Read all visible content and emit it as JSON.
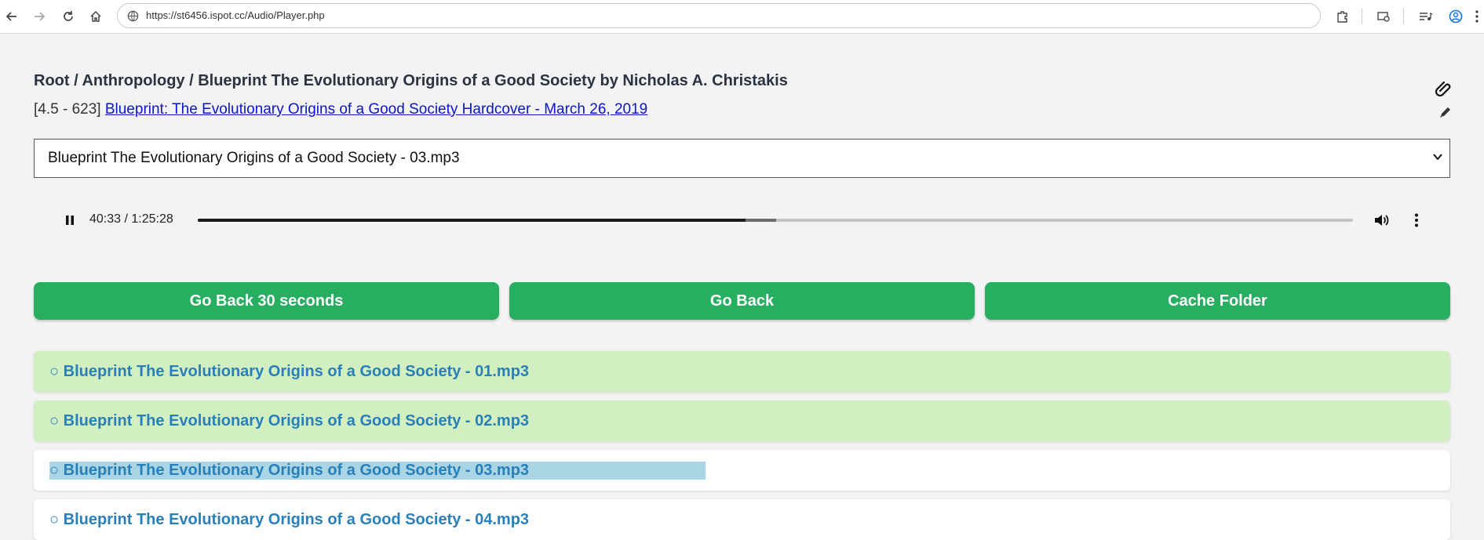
{
  "browser": {
    "url": "https://st6456.ispot.cc/Audio/Player.php"
  },
  "page": {
    "breadcrumb": "Root / Anthropology / Blueprint The Evolutionary Origins of a Good Society by Nicholas A. Christakis",
    "rating_prefix": "[4.5 - 623]",
    "book_link": "Blueprint: The Evolutionary Origins of a Good Society Hardcover - March 26, 2019",
    "selected_file": "Blueprint The Evolutionary Origins of a Good Society - 03.mp3"
  },
  "player": {
    "time": "40:33 / 1:25:28",
    "progress": 0.474,
    "buffered": 0.501
  },
  "buttons": {
    "back30": "Go Back 30 seconds",
    "back": "Go Back",
    "cache": "Cache Folder"
  },
  "files": [
    {
      "label": "○ Blueprint The Evolutionary Origins of a Good Society - 01.mp3",
      "state": "played"
    },
    {
      "label": "○ Blueprint The Evolutionary Origins of a Good Society - 02.mp3",
      "state": "played"
    },
    {
      "label": "○ Blueprint The Evolutionary Origins of a Good Society - 03.mp3",
      "state": "current"
    },
    {
      "label": "○ Blueprint The Evolutionary Origins of a Good Society - 04.mp3",
      "state": "current"
    }
  ],
  "colors": {
    "button": "#27ae60",
    "played_row": "#d1efc0",
    "link": "#2980b9",
    "highlight": "#a9d5e4"
  }
}
